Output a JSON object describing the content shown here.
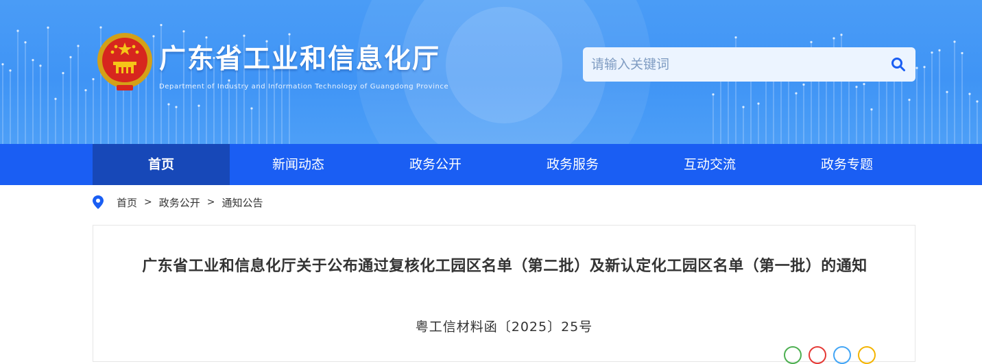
{
  "header": {
    "title": "广东省工业和信息化厅",
    "subtitle": "Department of Industry and Information Technology of Guangdong Province",
    "emblem_icon": "national-emblem-icon"
  },
  "search": {
    "placeholder": "请输入关键词",
    "value": "",
    "icon": "search-icon"
  },
  "nav": {
    "items": [
      {
        "label": "首页",
        "active": true
      },
      {
        "label": "新闻动态",
        "active": false
      },
      {
        "label": "政务公开",
        "active": false
      },
      {
        "label": "政务服务",
        "active": false
      },
      {
        "label": "互动交流",
        "active": false
      },
      {
        "label": "政务专题",
        "active": false
      }
    ]
  },
  "breadcrumb": {
    "icon": "location-pin-icon",
    "items": [
      "首页",
      "政务公开",
      "通知公告"
    ],
    "separator": ">"
  },
  "article": {
    "title": "广东省工业和信息化厅关于公布通过复核化工园区名单（第二批）及新认定化工园区名单（第一批）的通知",
    "doc_number": "粤工信材料函〔2025〕25号",
    "share_buttons": [
      {
        "icon": "wechat-icon",
        "color": "#4caf50"
      },
      {
        "icon": "weibo-icon",
        "color": "#e53935"
      },
      {
        "icon": "qq-icon",
        "color": "#42a5f5"
      },
      {
        "icon": "qzone-icon",
        "color": "#f4b400"
      }
    ]
  },
  "colors": {
    "banner_blue": "#4a9cf6",
    "nav_blue": "#1a5ef3",
    "nav_active": "#1748b8",
    "text": "#333333"
  }
}
